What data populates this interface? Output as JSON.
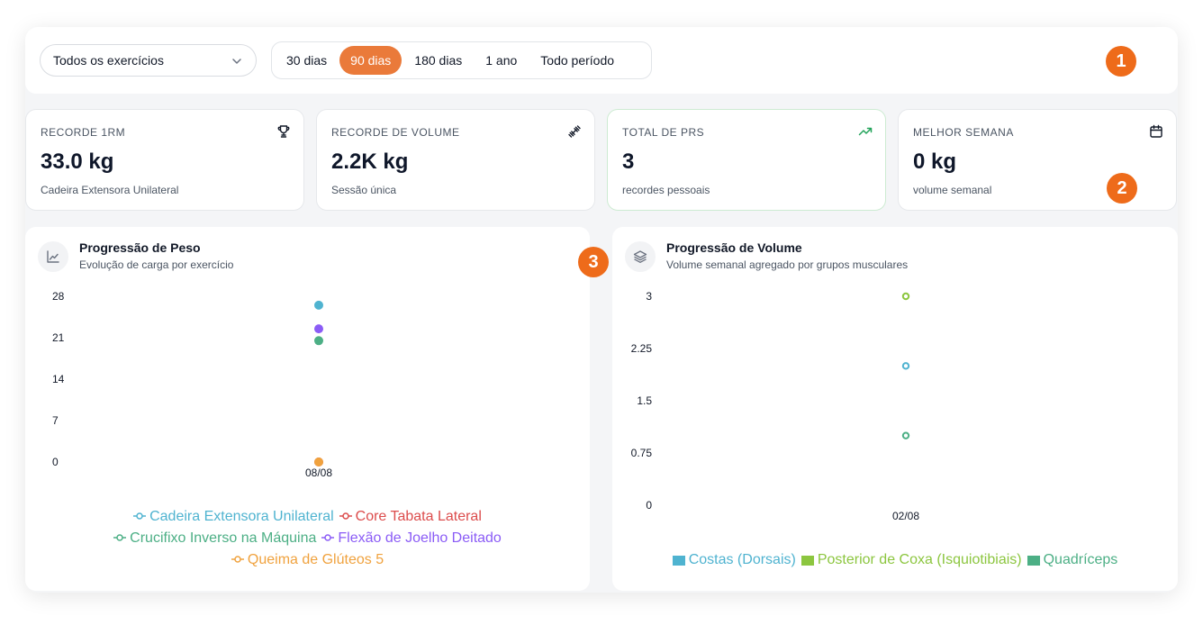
{
  "filters": {
    "exercise_select": "Todos os exercícios",
    "periods": [
      "30 dias",
      "90 dias",
      "180 dias",
      "1 ano",
      "Todo período"
    ],
    "active_period": "90 dias"
  },
  "badges": [
    "1",
    "2",
    "3"
  ],
  "stats": [
    {
      "label": "RECORDE 1RM",
      "value": "33.0 kg",
      "sub": "Cadeira Extensora Unilateral",
      "icon": "trophy-icon"
    },
    {
      "label": "RECORDE DE VOLUME",
      "value": "2.2K kg",
      "sub": "Sessão única",
      "icon": "dumbbell-icon"
    },
    {
      "label": "TOTAL DE PRS",
      "value": "3",
      "sub": "recordes pessoais",
      "icon": "trending-up-icon"
    },
    {
      "label": "MELHOR SEMANA",
      "value": "0 kg",
      "sub": "volume semanal",
      "icon": "calendar-icon"
    }
  ],
  "weight_chart": {
    "title": "Progressão de Peso",
    "subtitle": "Evolução de carga por exercício",
    "icon": "line-chart-icon"
  },
  "volume_chart": {
    "title": "Progressão de Volume",
    "subtitle": "Volume semanal agregado por grupos musculares",
    "icon": "layers-icon"
  },
  "colors": {
    "accent": "#ea7a3a",
    "badge": "#ee6b1a",
    "blue": "#4fb3d0",
    "red": "#dc4c4c",
    "teal": "#4caf85",
    "purple": "#8b5cf6",
    "orange": "#f0a23e",
    "lime": "#8cc63f"
  },
  "chart_data": [
    {
      "type": "scatter",
      "x": [
        "08/08"
      ],
      "ylim": [
        0,
        28
      ],
      "yticks": [
        "0",
        "7",
        "14",
        "21",
        "28"
      ],
      "series": [
        {
          "name": "Cadeira Extensora Unilateral",
          "color": "#4fb3d0",
          "values": [
            26.5
          ]
        },
        {
          "name": "Core Tabata Lateral",
          "color": "#dc4c4c",
          "values": [
            0
          ]
        },
        {
          "name": "Crucifixo Inverso na Máquina",
          "color": "#4caf85",
          "values": [
            20.5
          ]
        },
        {
          "name": "Flexão de Joelho Deitado",
          "color": "#8b5cf6",
          "values": [
            22.5
          ]
        },
        {
          "name": "Queima de Glúteos 5",
          "color": "#f0a23e",
          "values": [
            0
          ]
        }
      ],
      "legend": "bottom"
    },
    {
      "type": "scatter",
      "x": [
        "02/08"
      ],
      "ylim": [
        0,
        3
      ],
      "yticks": [
        "0",
        "0.75",
        "1.5",
        "2.25",
        "3"
      ],
      "series": [
        {
          "name": "Costas (Dorsais)",
          "color": "#4fb3d0",
          "values": [
            2
          ]
        },
        {
          "name": "Posterior de Coxa (Isquiotibiais)",
          "color": "#8cc63f",
          "values": [
            3
          ]
        },
        {
          "name": "Quadríceps",
          "color": "#4caf85",
          "values": [
            1
          ]
        }
      ],
      "legend": "bottom"
    }
  ]
}
